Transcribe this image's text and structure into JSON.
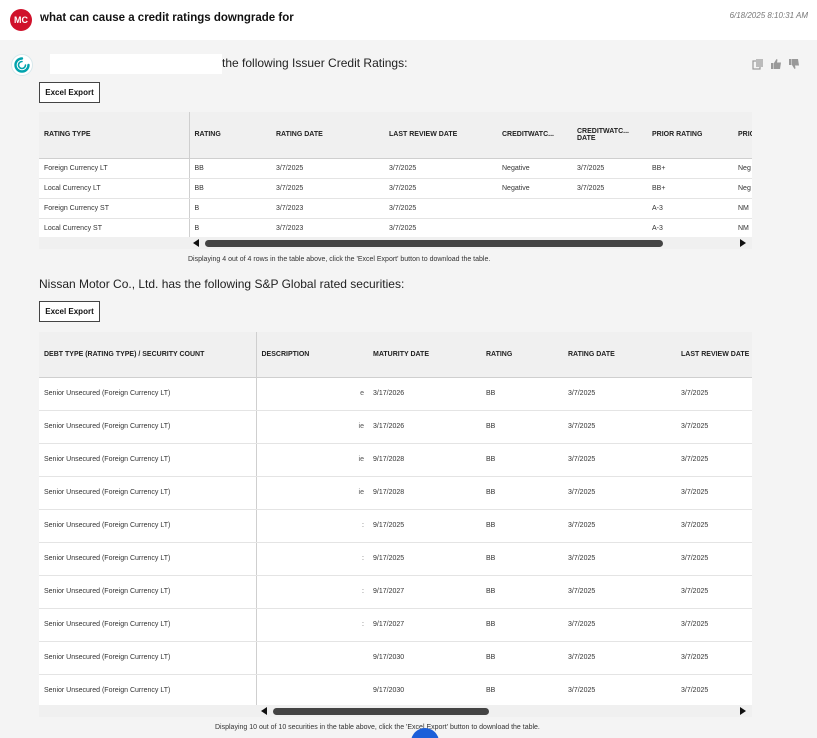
{
  "user_message": {
    "avatar_initials": "MC",
    "question": "what can cause a credit ratings downgrade for",
    "timestamp": "6/18/2025 8:10:31 AM"
  },
  "response": {
    "intro_suffix": "the following Issuer Credit Ratings:",
    "export_label": "Excel Export",
    "ratings_table": {
      "headers": [
        "RATING TYPE",
        "RATING",
        "RATING DATE",
        "LAST REVIEW DATE",
        "CREDITWATC...",
        "CREDITWATC... DATE",
        "PRIOR RATING",
        "PRIC CRE"
      ],
      "rows": [
        [
          "Foreign Currency LT",
          "BB",
          "3/7/2025",
          "3/7/2025",
          "Negative",
          "3/7/2025",
          "BB+",
          "Neg"
        ],
        [
          "Local Currency LT",
          "BB",
          "3/7/2025",
          "3/7/2025",
          "Negative",
          "3/7/2025",
          "BB+",
          "Neg"
        ],
        [
          "Foreign Currency ST",
          "B",
          "3/7/2023",
          "3/7/2025",
          "",
          "",
          "A-3",
          "NM"
        ],
        [
          "Local Currency ST",
          "B",
          "3/7/2023",
          "3/7/2025",
          "",
          "",
          "A-3",
          "NM"
        ]
      ],
      "caption": "Displaying 4 out of 4 rows in the table above, click the 'Excel Export' button to download the table."
    },
    "securities_title": "Nissan Motor Co., Ltd. has the following S&P Global rated securities:",
    "securities_table": {
      "headers": [
        "DEBT TYPE (RATING TYPE) / SECURITY COUNT",
        "DESCRIPTION",
        "MATURITY DATE",
        "RATING",
        "RATING DATE",
        "LAST REVIEW DATE"
      ],
      "rows": [
        [
          "Senior Unsecured (Foreign Currency LT)",
          "e",
          "3/17/2026",
          "BB",
          "3/7/2025",
          "3/7/2025"
        ],
        [
          "Senior Unsecured (Foreign Currency LT)",
          "ie",
          "3/17/2026",
          "BB",
          "3/7/2025",
          "3/7/2025"
        ],
        [
          "Senior Unsecured (Foreign Currency LT)",
          "ie",
          "9/17/2028",
          "BB",
          "3/7/2025",
          "3/7/2025"
        ],
        [
          "Senior Unsecured (Foreign Currency LT)",
          "ie",
          "9/17/2028",
          "BB",
          "3/7/2025",
          "3/7/2025"
        ],
        [
          "Senior Unsecured (Foreign Currency LT)",
          ":",
          "9/17/2025",
          "BB",
          "3/7/2025",
          "3/7/2025"
        ],
        [
          "Senior Unsecured (Foreign Currency LT)",
          ":",
          "9/17/2025",
          "BB",
          "3/7/2025",
          "3/7/2025"
        ],
        [
          "Senior Unsecured (Foreign Currency LT)",
          ":",
          "9/17/2027",
          "BB",
          "3/7/2025",
          "3/7/2025"
        ],
        [
          "Senior Unsecured (Foreign Currency LT)",
          ":",
          "9/17/2027",
          "BB",
          "3/7/2025",
          "3/7/2025"
        ],
        [
          "Senior Unsecured (Foreign Currency LT)",
          "",
          "9/17/2030",
          "BB",
          "3/7/2025",
          "3/7/2025"
        ],
        [
          "Senior Unsecured (Foreign Currency LT)",
          "",
          "9/17/2030",
          "BB",
          "3/7/2025",
          "3/7/2025"
        ]
      ],
      "caption": "Displaying 10 out of 10 securities in the table above, click the 'Excel Export' button to download the table."
    },
    "icons": [
      "logo-icon",
      "copy-icon",
      "thumbs-up-icon",
      "thumbs-down-icon"
    ],
    "colors": {
      "avatar": "#d0112b",
      "logo": "#00a3ad",
      "fab": "#1b5fd9"
    }
  }
}
